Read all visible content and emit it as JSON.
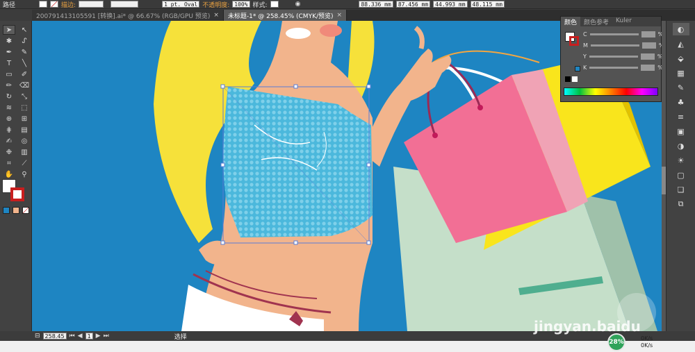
{
  "toolbar": {
    "mode_label": "路径",
    "stroke_label": "描边:",
    "brush_value": "1 pt. Oval",
    "opacity_label": "不透明度:",
    "opacity_value": "100%",
    "style_label": "样式:",
    "x_value": "88.336 mm",
    "y_value": "87.456 mm",
    "w_value": "44.993 mm",
    "h_value": "48.115 mm"
  },
  "tabs": [
    {
      "label": "200791413105591 [转换].ai* @ 66.67% (RGB/GPU 预览)",
      "close": "×",
      "active": false
    },
    {
      "label": "未标题-1* @ 258.45% (CMYK/预览)",
      "close": "×",
      "active": true
    }
  ],
  "tools": [
    "selection-tool",
    "direct-selection-tool",
    "magic-wand-tool",
    "lasso-tool",
    "pen-tool",
    "curvature-tool",
    "type-tool",
    "line-tool",
    "rectangle-tool",
    "paintbrush-tool",
    "pencil-tool",
    "eraser-tool",
    "rotate-tool",
    "scale-tool",
    "width-tool",
    "free-transform-tool",
    "shape-builder-tool",
    "perspective-tool",
    "mesh-tool",
    "gradient-tool",
    "eyedropper-tool",
    "blend-tool",
    "symbol-sprayer-tool",
    "graph-tool",
    "artboard-tool",
    "slice-tool",
    "hand-tool",
    "zoom-tool"
  ],
  "color_panel": {
    "tabs": [
      "颜色",
      "颜色参考",
      "Kuler"
    ],
    "channels": [
      {
        "name": "C",
        "unit": "%"
      },
      {
        "name": "M",
        "unit": "%"
      },
      {
        "name": "Y",
        "unit": "%"
      },
      {
        "name": "K",
        "unit": "%"
      }
    ]
  },
  "status": {
    "zoom": "258.45",
    "page": "1",
    "tool_name": "选择"
  },
  "network": {
    "percent": "28%",
    "up": "0K/s",
    "down": "0K/s"
  },
  "watermark": "jingyan.baidu",
  "colors": {
    "canvas_bg": "#1e85c2",
    "hair": "#f6e13a",
    "skin": "#f2b48c",
    "top_pattern": "#4bb8dc",
    "bag_pink": "#f26f95",
    "bag_yellow": "#f9e51c",
    "bag_mint": "#c5dfc9"
  }
}
